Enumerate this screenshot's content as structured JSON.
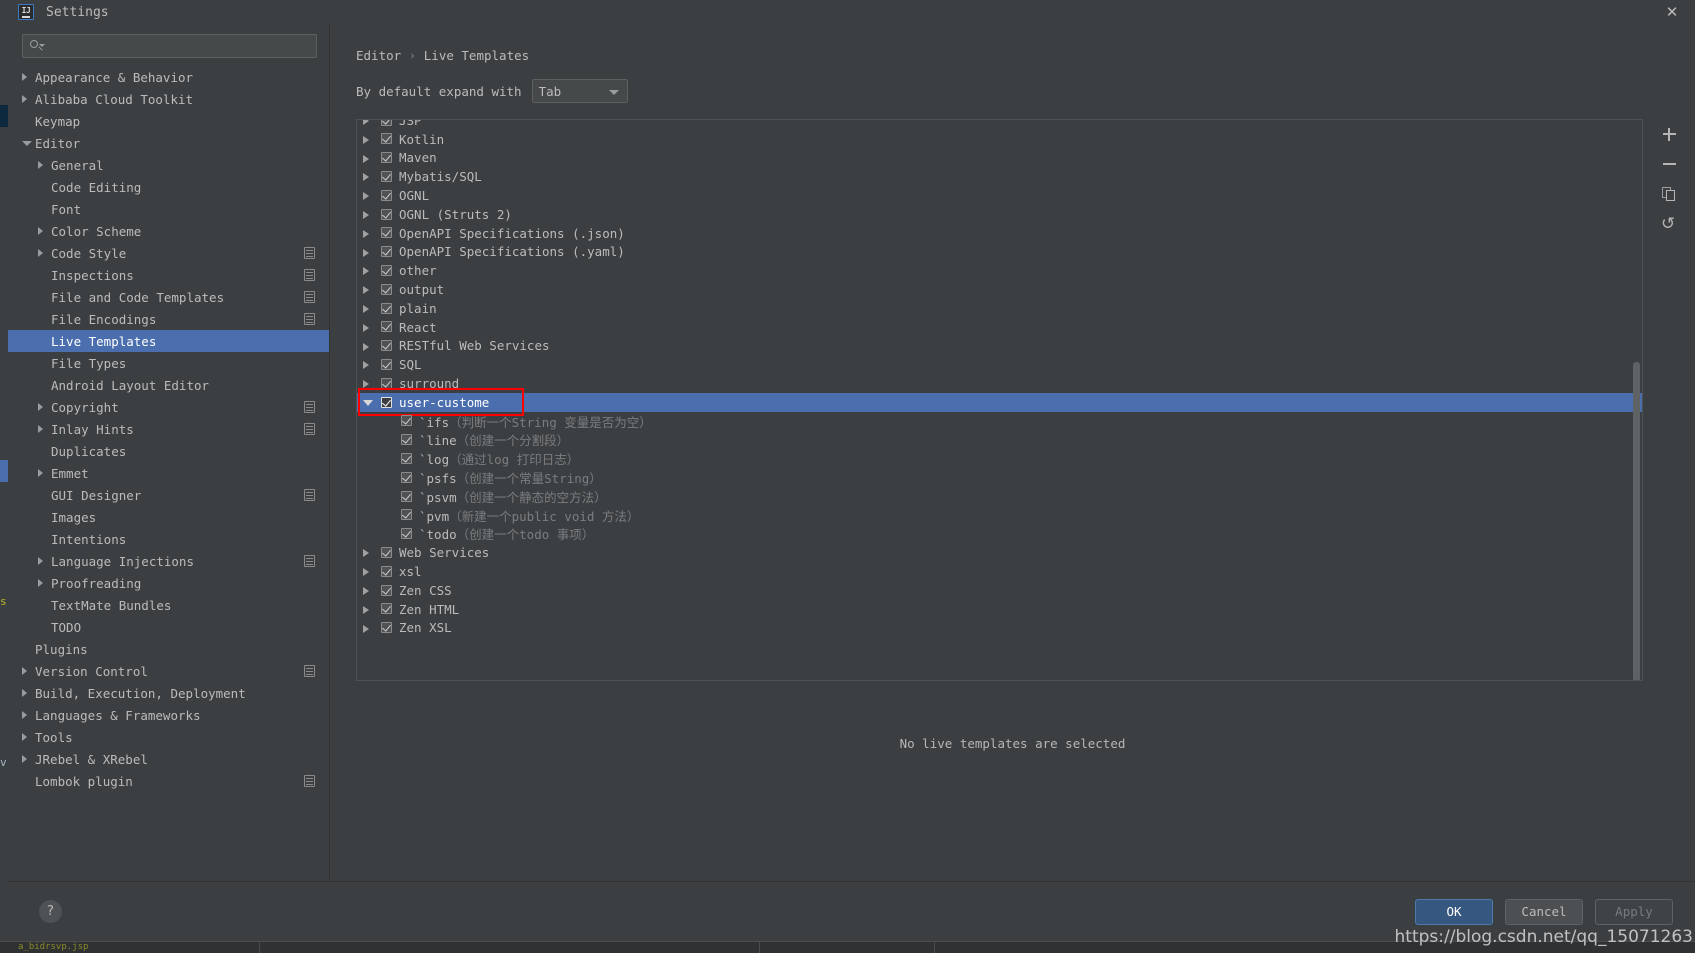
{
  "window": {
    "title": "Settings",
    "logo_text": "IJ",
    "close_icon": "✕"
  },
  "sidebar": {
    "search": {
      "value": "",
      "placeholder": ""
    },
    "items": [
      {
        "label": "Appearance & Behavior",
        "indent": 0,
        "arrow": "closed",
        "config": false
      },
      {
        "label": "Alibaba Cloud Toolkit",
        "indent": 0,
        "arrow": "closed",
        "config": false
      },
      {
        "label": "Keymap",
        "indent": 0,
        "arrow": "none",
        "config": false
      },
      {
        "label": "Editor",
        "indent": 0,
        "arrow": "open",
        "config": false
      },
      {
        "label": "General",
        "indent": 1,
        "arrow": "closed",
        "config": false
      },
      {
        "label": "Code Editing",
        "indent": 1,
        "arrow": "none",
        "config": false
      },
      {
        "label": "Font",
        "indent": 1,
        "arrow": "none",
        "config": false
      },
      {
        "label": "Color Scheme",
        "indent": 1,
        "arrow": "closed",
        "config": false
      },
      {
        "label": "Code Style",
        "indent": 1,
        "arrow": "closed",
        "config": true
      },
      {
        "label": "Inspections",
        "indent": 1,
        "arrow": "none",
        "config": true
      },
      {
        "label": "File and Code Templates",
        "indent": 1,
        "arrow": "none",
        "config": true
      },
      {
        "label": "File Encodings",
        "indent": 1,
        "arrow": "none",
        "config": true
      },
      {
        "label": "Live Templates",
        "indent": 1,
        "arrow": "none",
        "config": false,
        "selected": true
      },
      {
        "label": "File Types",
        "indent": 1,
        "arrow": "none",
        "config": false
      },
      {
        "label": "Android Layout Editor",
        "indent": 1,
        "arrow": "none",
        "config": false
      },
      {
        "label": "Copyright",
        "indent": 1,
        "arrow": "closed",
        "config": true
      },
      {
        "label": "Inlay Hints",
        "indent": 1,
        "arrow": "closed",
        "config": true
      },
      {
        "label": "Duplicates",
        "indent": 1,
        "arrow": "none",
        "config": false
      },
      {
        "label": "Emmet",
        "indent": 1,
        "arrow": "closed",
        "config": false
      },
      {
        "label": "GUI Designer",
        "indent": 1,
        "arrow": "none",
        "config": true
      },
      {
        "label": "Images",
        "indent": 1,
        "arrow": "none",
        "config": false
      },
      {
        "label": "Intentions",
        "indent": 1,
        "arrow": "none",
        "config": false
      },
      {
        "label": "Language Injections",
        "indent": 1,
        "arrow": "closed",
        "config": true
      },
      {
        "label": "Proofreading",
        "indent": 1,
        "arrow": "closed",
        "config": false
      },
      {
        "label": "TextMate Bundles",
        "indent": 1,
        "arrow": "none",
        "config": false
      },
      {
        "label": "TODO",
        "indent": 1,
        "arrow": "none",
        "config": false
      },
      {
        "label": "Plugins",
        "indent": 0,
        "arrow": "none",
        "config": false
      },
      {
        "label": "Version Control",
        "indent": 0,
        "arrow": "closed",
        "config": true
      },
      {
        "label": "Build, Execution, Deployment",
        "indent": 0,
        "arrow": "closed",
        "config": false
      },
      {
        "label": "Languages & Frameworks",
        "indent": 0,
        "arrow": "closed",
        "config": false
      },
      {
        "label": "Tools",
        "indent": 0,
        "arrow": "closed",
        "config": false
      },
      {
        "label": "JRebel & XRebel",
        "indent": 0,
        "arrow": "closed",
        "config": false
      },
      {
        "label": "Lombok plugin",
        "indent": 0,
        "arrow": "none",
        "config": true
      }
    ]
  },
  "main": {
    "breadcrumb": {
      "parent": "Editor",
      "separator": "›",
      "current": "Live Templates"
    },
    "expand_with": {
      "label": "By default expand with",
      "value": "Tab"
    },
    "empty_message": "No live templates are selected",
    "templates": [
      {
        "label": "JSP",
        "level": 0,
        "arrow": true,
        "checked": true,
        "partial": true
      },
      {
        "label": "Kotlin",
        "level": 0,
        "arrow": true,
        "checked": true
      },
      {
        "label": "Maven",
        "level": 0,
        "arrow": true,
        "checked": true
      },
      {
        "label": "Mybatis/SQL",
        "level": 0,
        "arrow": true,
        "checked": true
      },
      {
        "label": "OGNL",
        "level": 0,
        "arrow": true,
        "checked": true
      },
      {
        "label": "OGNL (Struts 2)",
        "level": 0,
        "arrow": true,
        "checked": true
      },
      {
        "label": "OpenAPI Specifications (.json)",
        "level": 0,
        "arrow": true,
        "checked": true
      },
      {
        "label": "OpenAPI Specifications (.yaml)",
        "level": 0,
        "arrow": true,
        "checked": true
      },
      {
        "label": "other",
        "level": 0,
        "arrow": true,
        "checked": true
      },
      {
        "label": "output",
        "level": 0,
        "arrow": true,
        "checked": true
      },
      {
        "label": "plain",
        "level": 0,
        "arrow": true,
        "checked": true
      },
      {
        "label": "React",
        "level": 0,
        "arrow": true,
        "checked": true
      },
      {
        "label": "RESTful Web Services",
        "level": 0,
        "arrow": true,
        "checked": true
      },
      {
        "label": "SQL",
        "level": 0,
        "arrow": true,
        "checked": true
      },
      {
        "label": "surround",
        "level": 0,
        "arrow": true,
        "checked": true
      },
      {
        "label": "user-custome",
        "level": 0,
        "arrow": true,
        "arrow_open": true,
        "checked": true,
        "selected": true,
        "highlighted": true
      },
      {
        "label": "`ifs（判断一个String 变量是否为空）",
        "key": "`ifs",
        "desc": "（判断一个String 变量是否为空）",
        "level": 1,
        "arrow": false,
        "checked": true
      },
      {
        "label": "`line（创建一个分割段）",
        "key": "`line",
        "desc": "（创建一个分割段）",
        "level": 1,
        "arrow": false,
        "checked": true
      },
      {
        "label": "`log（通过log 打印日志）",
        "key": "`log",
        "desc": "（通过log 打印日志）",
        "level": 1,
        "arrow": false,
        "checked": true
      },
      {
        "label": "`psfs（创建一个常量String）",
        "key": "`psfs",
        "desc": "（创建一个常量String）",
        "level": 1,
        "arrow": false,
        "checked": true
      },
      {
        "label": "`psvm（创建一个静态的空方法）",
        "key": "`psvm",
        "desc": "（创建一个静态的空方法）",
        "level": 1,
        "arrow": false,
        "checked": true
      },
      {
        "label": "`pvm（新建一个public void 方法）",
        "key": "`pvm",
        "desc": "（新建一个public void 方法）",
        "level": 1,
        "arrow": false,
        "checked": true
      },
      {
        "label": "`todo（创建一个todo 事项）",
        "key": "`todo",
        "desc": "（创建一个todo 事项）",
        "level": 1,
        "arrow": false,
        "checked": true
      },
      {
        "label": "Web Services",
        "level": 0,
        "arrow": true,
        "checked": true
      },
      {
        "label": "xsl",
        "level": 0,
        "arrow": true,
        "checked": true
      },
      {
        "label": "Zen CSS",
        "level": 0,
        "arrow": true,
        "checked": true
      },
      {
        "label": "Zen HTML",
        "level": 0,
        "arrow": true,
        "checked": true
      },
      {
        "label": "Zen XSL",
        "level": 0,
        "arrow": true,
        "checked": true
      }
    ],
    "toolbar": [
      {
        "name": "add",
        "glyph": "+"
      },
      {
        "name": "remove",
        "glyph": "−"
      },
      {
        "name": "copy",
        "glyph": "⧉"
      },
      {
        "name": "revert",
        "glyph": "↺"
      }
    ]
  },
  "footer": {
    "help_glyph": "?",
    "ok_label": "OK",
    "cancel_label": "Cancel",
    "apply_label": "Apply"
  },
  "watermark": "https://blog.csdn.net/qq_15071263",
  "colors": {
    "selection_blue": "#4b6eaf",
    "highlight_red": "#ff0000",
    "primary_button": "#365880",
    "panel_bg": "#3c3f41"
  }
}
